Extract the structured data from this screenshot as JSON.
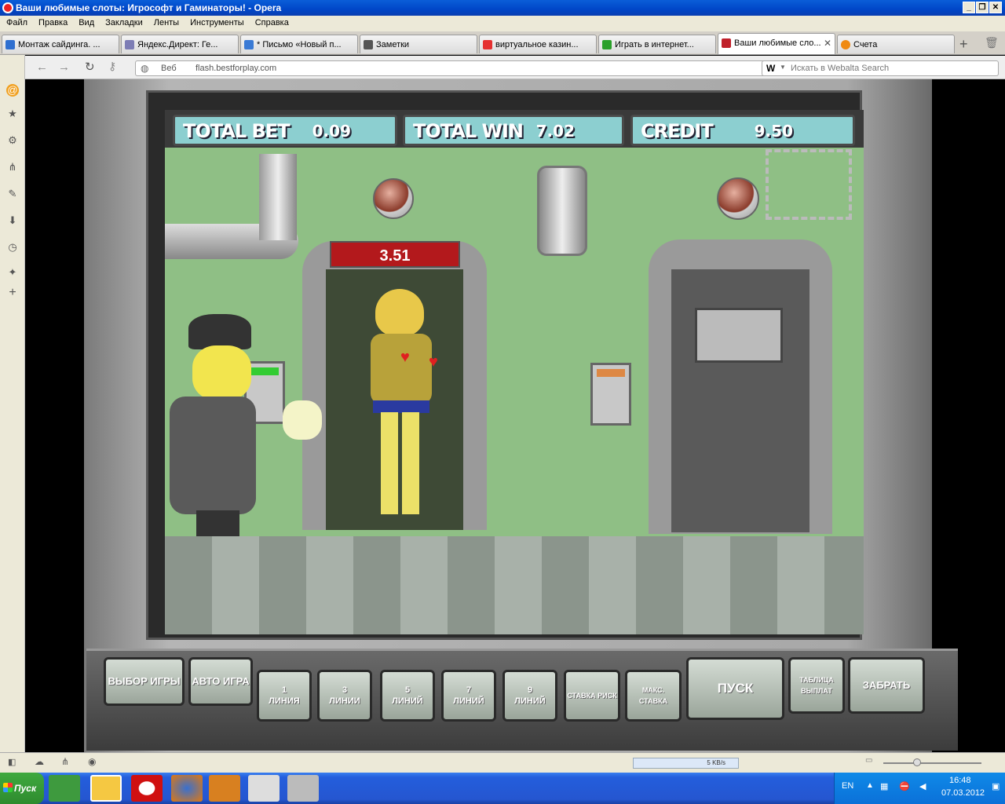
{
  "window": {
    "title": "Ваши любимые слоты: Игрософт и Гаминаторы! - Opera"
  },
  "menu": [
    "Файл",
    "Правка",
    "Вид",
    "Закладки",
    "Ленты",
    "Инструменты",
    "Справка"
  ],
  "tabs": [
    {
      "label": "Монтаж сайдинга. ...",
      "icon": "page-icon",
      "color": "#2f6fd0"
    },
    {
      "label": "Яндекс.Директ: Ге...",
      "icon": "yandex-direct-icon",
      "color": "#7d7db5"
    },
    {
      "label": "* Письмо «Новый п...",
      "icon": "mail-icon",
      "color": "#3a7ad5"
    },
    {
      "label": "Заметки",
      "icon": "notes-icon",
      "color": "#555555"
    },
    {
      "label": "виртуальное казин...",
      "icon": "yandex-icon",
      "color": "#e53030"
    },
    {
      "label": "Играть в интернет...",
      "icon": "clover-icon",
      "color": "#2aa02a"
    },
    {
      "label": "Ваши любимые сло...",
      "icon": "opera-tab-icon",
      "color": "#c0202a"
    },
    {
      "label": "Счета",
      "icon": "q-icon",
      "color": "#f08a10"
    }
  ],
  "address": {
    "scope": "Веб",
    "url": "flash.bestforplay.com"
  },
  "search": {
    "engine": "W",
    "placeholder": "Искать в Webalta Search"
  },
  "game": {
    "total_bet_label": "TOTAL BET",
    "total_bet": "0.09",
    "total_win_label": "TOTAL WIN",
    "total_win": "7.02",
    "credit_label": "CREDIT",
    "credit": "9.50",
    "door_win": "3.51",
    "buttons": {
      "select_game": "ВЫБОР ИГРЫ",
      "auto_game": "АВТО ИГРА",
      "line1_num": "1",
      "line1_lbl": "ЛИНИЯ",
      "line3_num": "3",
      "line3_lbl": "ЛИНИИ",
      "line5_num": "5",
      "line5_lbl": "ЛИНИЙ",
      "line7_num": "7",
      "line7_lbl": "ЛИНИЙ",
      "line9_num": "9",
      "line9_lbl": "ЛИНИЙ",
      "bet_risk": "СТАВКА РИСК",
      "max_bet": "МАКС. СТАВКА",
      "start": "ПУСК",
      "paytable": "ТАБЛИЦА ВЫПЛАТ",
      "take": "ЗАБРАТЬ"
    }
  },
  "status": {
    "speed": "5 KB/s"
  },
  "taskbar": {
    "start": "Пуск",
    "lang": "EN",
    "time": "16:48",
    "date": "07.03.2012"
  }
}
